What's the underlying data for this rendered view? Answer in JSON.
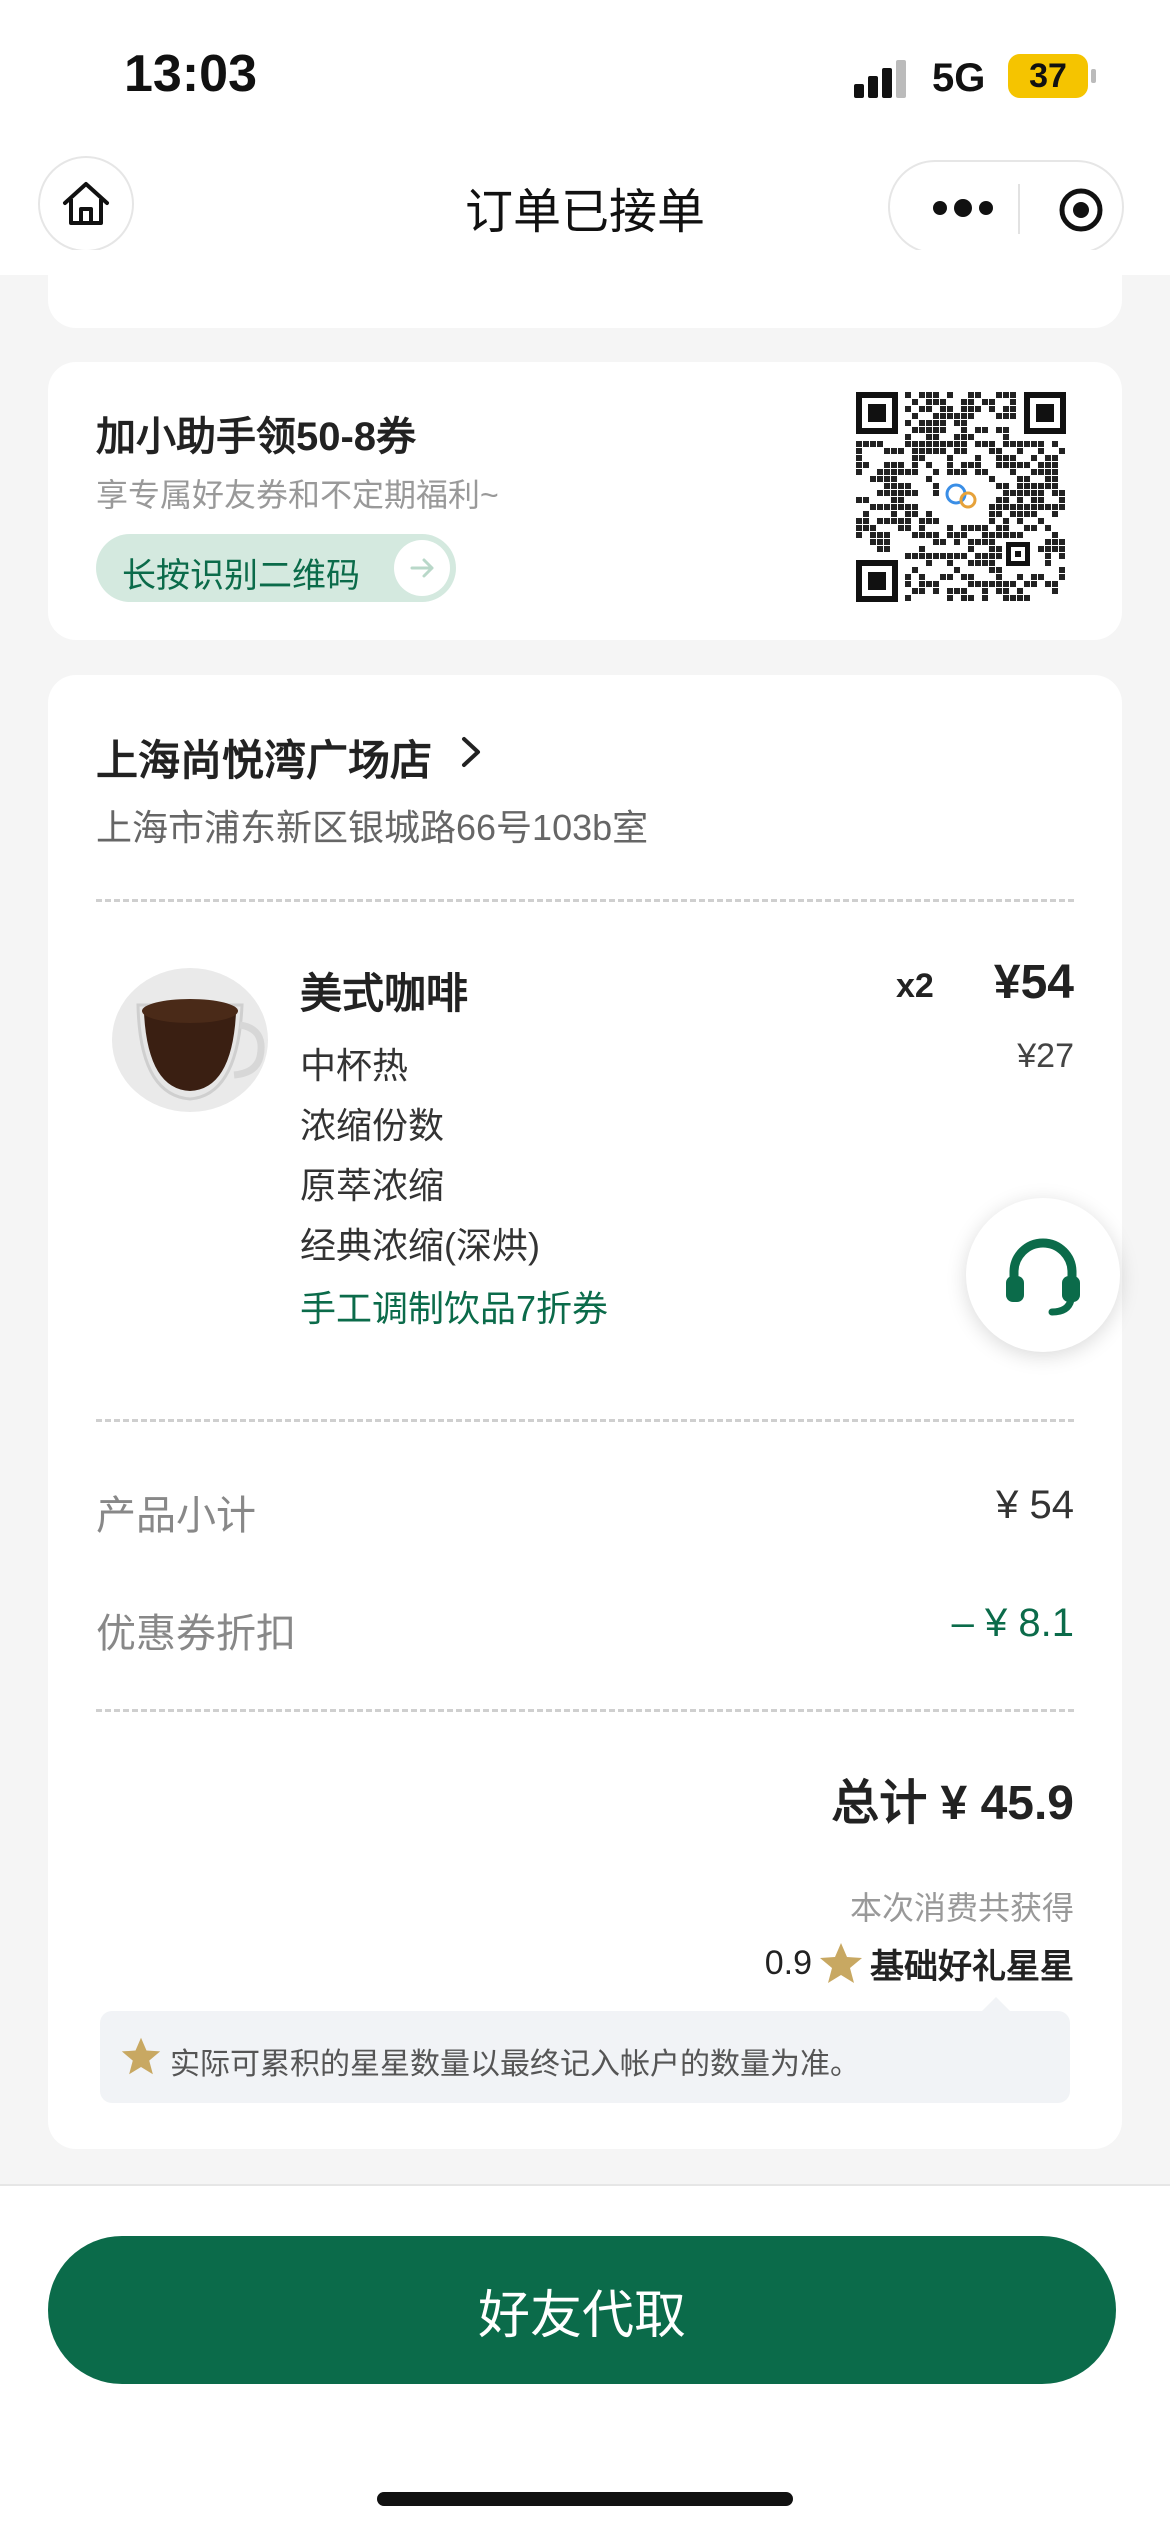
{
  "status_bar": {
    "time": "13:03",
    "network": "5G",
    "battery": "37"
  },
  "nav": {
    "title": "订单已接单"
  },
  "assistant": {
    "title": "加小助手领50-8券",
    "subtitle": "享专属好友券和不定期福利~",
    "qr_button": "长按识别二维码"
  },
  "store": {
    "name": "上海尚悦湾广场店",
    "address": "上海市浦东新区银城路66号103b室"
  },
  "product": {
    "name": "美式咖啡",
    "quantity": "x2",
    "total_price": "¥54",
    "unit_price": "¥27",
    "specs": [
      "中杯热",
      "浓缩份数",
      "原萃浓缩",
      "经典浓缩(深烘)"
    ],
    "coupon": "手工调制饮品7折券"
  },
  "summary": {
    "subtotal_label": "产品小计",
    "subtotal_value": "¥ 54",
    "discount_label": "优惠券折扣",
    "discount_value": "– ¥ 8.1",
    "total": "总计 ¥ 45.9"
  },
  "rewards": {
    "earn_label": "本次消费共获得",
    "stars": "0.9",
    "star_type": "基础好礼星星",
    "notice": "实际可累积的星星数量以最终记入帐户的数量为准。"
  },
  "cta": {
    "label": "好友代取"
  },
  "colors": {
    "brand_green": "#0b6b4a",
    "star_gold": "#c8a862",
    "pill_bg": "#d4e9df"
  },
  "icons": [
    "home-icon",
    "more-dots-icon",
    "target-icon",
    "arrow-right-icon",
    "qr-code-icon",
    "chevron-right-icon",
    "star-icon",
    "headset-icon"
  ]
}
